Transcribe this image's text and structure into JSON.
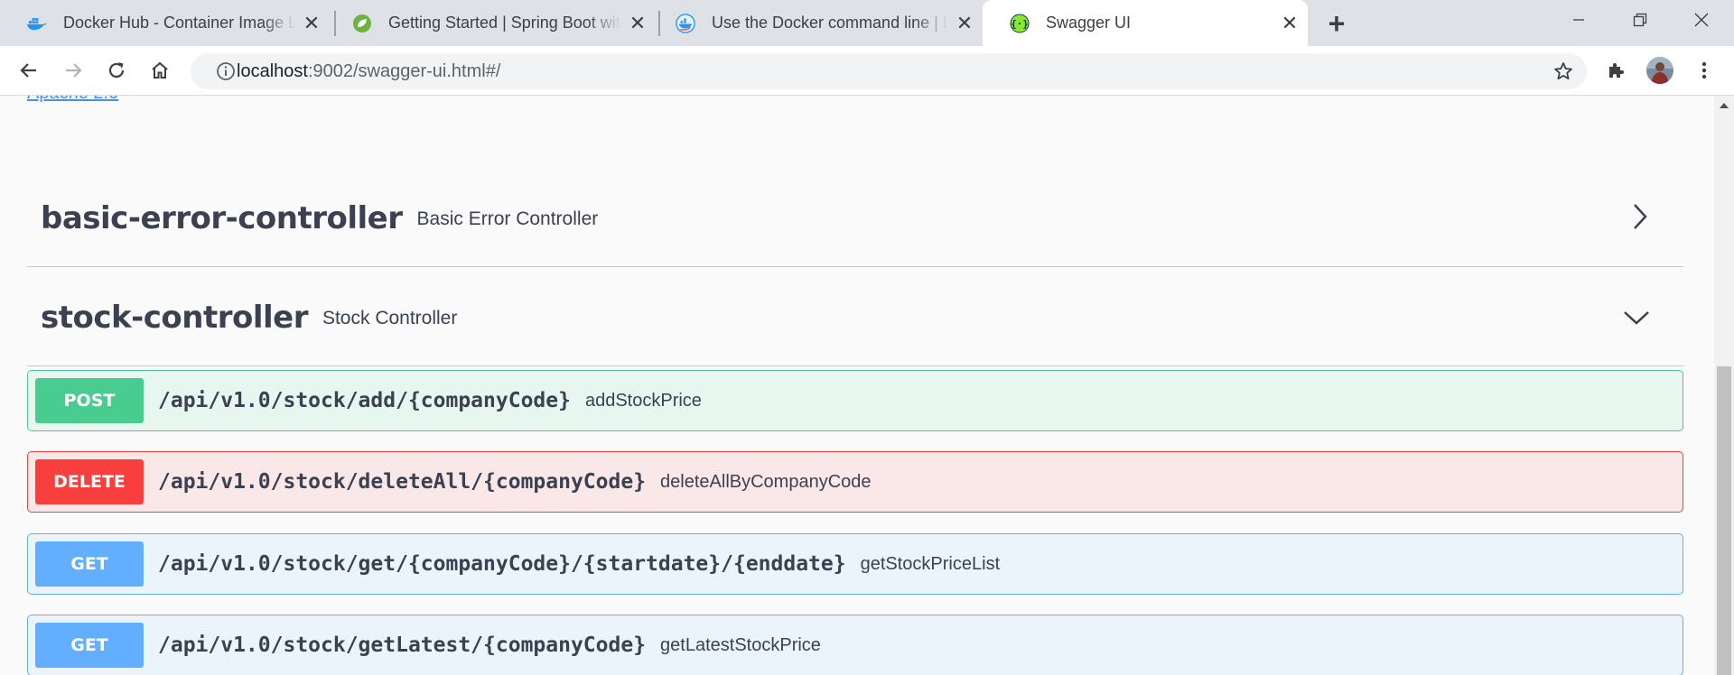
{
  "browser": {
    "tabs": [
      {
        "title": "Docker Hub - Container Image Li",
        "icon": "docker-icon",
        "active": false
      },
      {
        "title": "Getting Started | Spring Boot wit",
        "icon": "spring-icon",
        "active": false
      },
      {
        "title": "Use the Docker command line | D",
        "icon": "docker-docs-icon",
        "active": false
      },
      {
        "title": "Swagger UI",
        "icon": "swagger-icon",
        "active": true
      }
    ],
    "close_glyph": "✕",
    "new_tab_glyph": "+",
    "address": {
      "host": "localhost",
      "path": ":9002/swagger-ui.html#/"
    }
  },
  "page": {
    "license_link": "Apache 2.0",
    "tags": [
      {
        "name": "basic-error-controller",
        "description": "Basic Error Controller",
        "expanded": false
      },
      {
        "name": "stock-controller",
        "description": "Stock Controller",
        "expanded": true
      }
    ],
    "operations": [
      {
        "method": "POST",
        "path": "/api/v1.0/stock/add/{companyCode}",
        "summary": "addStockPrice"
      },
      {
        "method": "DELETE",
        "path": "/api/v1.0/stock/deleteAll/{companyCode}",
        "summary": "deleteAllByCompanyCode"
      },
      {
        "method": "GET",
        "path": "/api/v1.0/stock/get/{companyCode}/{startdate}/{enddate}",
        "summary": "getStockPriceList"
      },
      {
        "method": "GET",
        "path": "/api/v1.0/stock/getLatest/{companyCode}",
        "summary": "getLatestStockPrice"
      }
    ]
  },
  "colors": {
    "post": "#49cc90",
    "delete": "#f93e3e",
    "get": "#61affe",
    "tab_strip": "#dee1e6"
  }
}
